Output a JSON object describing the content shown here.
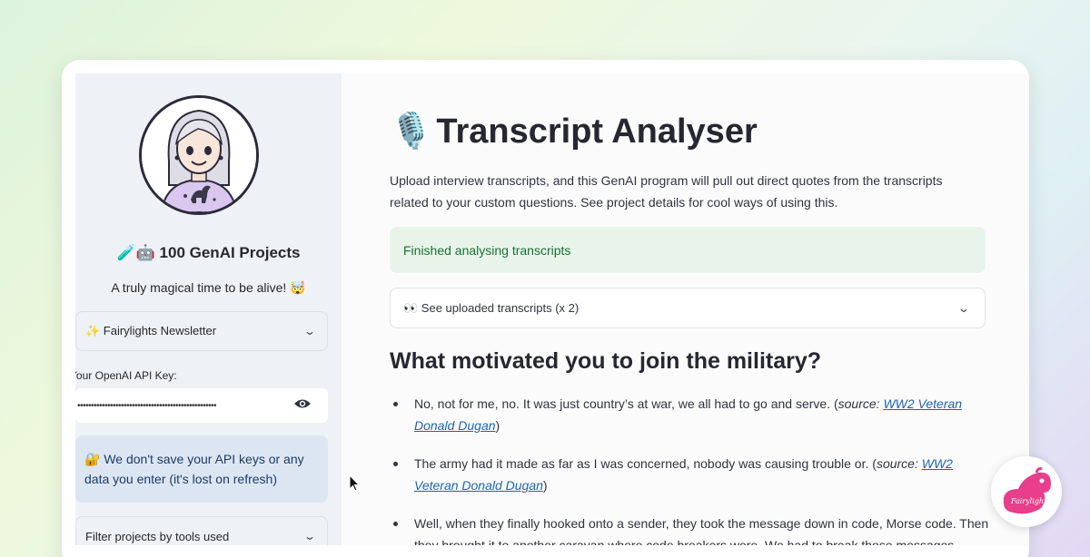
{
  "sidebar": {
    "title_icons": "🧪🤖",
    "title": "100 GenAI Projects",
    "subtitle": "A truly magical time to be alive! 🤯",
    "newsletter": "✨ Fairylights Newsletter",
    "api_label": "Your OpenAI API Key:",
    "api_value": "•••••••••••••••••••••••••••••••••••••••••••••••••••",
    "info": "🔐 We don't save your API keys or any data you enter (it's lost on refresh)",
    "filter": "Filter projects by tools used"
  },
  "main": {
    "title_icon": "🎙️",
    "title": "Transcript Analyser",
    "intro": "Upload interview transcripts, and this GenAI program will pull out direct quotes from the transcripts related to your custom questions. See project details for cool ways of using this.",
    "status": "Finished analysing transcripts",
    "uploaded": "👀 See uploaded transcripts (x 2)",
    "question": "What motivated you to join the military?",
    "quotes": [
      {
        "text": "No, not for me, no. It was just country’s at war, we all had to go and serve. (",
        "source_prefix": "source: ",
        "source": "WW2 Veteran Donald Dugan",
        "close": ")"
      },
      {
        "text": "The army had it made as far as I was concerned, nobody was causing trouble or. (",
        "source_prefix": "source: ",
        "source": "WW2 Veteran Donald Dugan",
        "close": ")"
      },
      {
        "text": "Well, when they finally hooked onto a sender, they took the message down in code, Morse code. Then they brought it to another caravan where code breakers were. We had to break those messages",
        "source_prefix": "",
        "source": "",
        "close": ""
      }
    ]
  },
  "logo": {
    "label": "Fairylights"
  },
  "colors": {
    "accent_pink": "#e83e8c",
    "success_bg": "#e8f4ea",
    "info_bg": "#dce6f3",
    "link": "#1c63b7"
  }
}
